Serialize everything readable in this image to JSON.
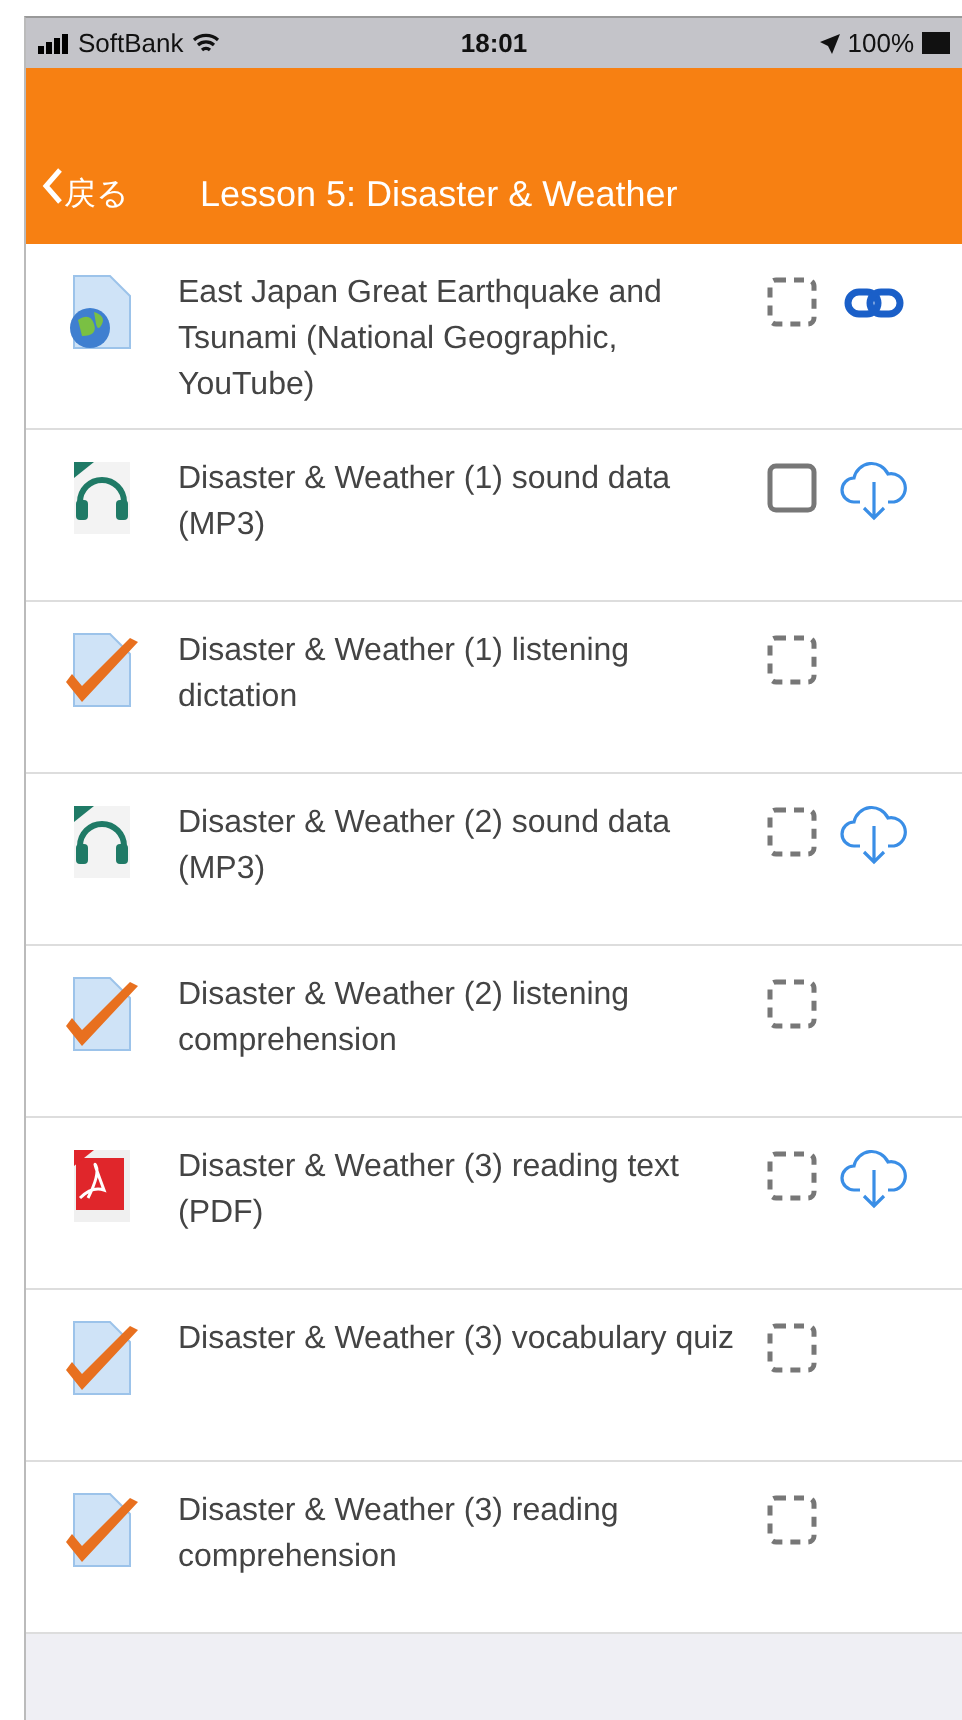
{
  "status_bar": {
    "carrier": "SoftBank",
    "time": "18:01",
    "battery": "100%"
  },
  "nav": {
    "back": "戻る",
    "title": "Lesson 5: Disaster & Weather"
  },
  "items": [
    {
      "kind": "url",
      "title": "East Japan Great Earthquake and Tsunami (National Geographic, YouTube)",
      "completion": {
        "kind": "auto"
      },
      "action": {
        "kind": "link"
      }
    },
    {
      "kind": "audio",
      "title": "Disaster & Weather (1) sound data (MP3)",
      "completion": {
        "kind": "manual"
      },
      "action": {
        "kind": "download"
      }
    },
    {
      "kind": "quiz",
      "title": "Disaster & Weather (1) listening dictation",
      "completion": {
        "kind": "auto"
      }
    },
    {
      "kind": "audio",
      "title": "Disaster & Weather (2) sound data (MP3)",
      "completion": {
        "kind": "auto"
      },
      "action": {
        "kind": "download"
      }
    },
    {
      "kind": "quiz",
      "title": "Disaster & Weather (2) listening comprehension",
      "completion": {
        "kind": "auto"
      }
    },
    {
      "kind": "pdf",
      "title": "Disaster & Weather (3) reading text (PDF)",
      "completion": {
        "kind": "auto"
      },
      "action": {
        "kind": "download"
      }
    },
    {
      "kind": "quiz",
      "title": "Disaster & Weather (3) vocabulary quiz",
      "completion": {
        "kind": "auto"
      }
    },
    {
      "kind": "quiz",
      "title": "Disaster & Weather (3) reading comprehension",
      "completion": {
        "kind": "auto"
      }
    }
  ]
}
